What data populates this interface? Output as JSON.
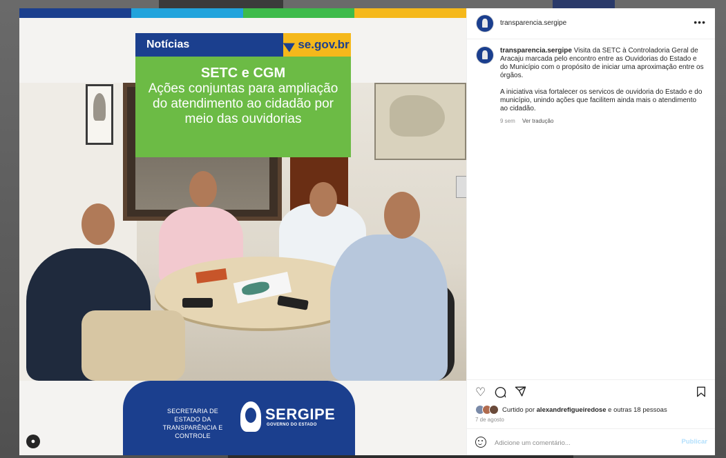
{
  "post_image": {
    "color_bar": [
      "#1b3f8e",
      "#22a3dc",
      "#3dbb4a",
      "#f5b81b"
    ],
    "news_tag": "Notícias",
    "gov_logo": "se.gov.br",
    "headline": "SETC e CGM",
    "subheadline": "Ações conjuntas para ampliação do atendimento ao cidadão por meio das ouvidorias",
    "secretaria": "SECRETARIA DE ESTADO DA TRANSPARÊNCIA E CONTROLE",
    "brand": "SERGIPE",
    "brand_sub": "GOVERNO DO ESTADO",
    "colors": {
      "blue": "#1b3f8e",
      "green": "#6cbb45",
      "yellow": "#f5b81b"
    }
  },
  "panel": {
    "username": "transparencia.sergipe",
    "more_icon": "more-horizontal-icon",
    "caption": {
      "username": "transparencia.sergipe",
      "paragraph1": "Visita da SETC à Controladoria Geral de Aracaju marcada pelo encontro entre as Ouvidorias do Estado e do Município com o propósito de iniciar uma aproximação entre os órgãos.",
      "paragraph2": "A iniciativa visa fortalecer os servicos de ouvidoria do Estado e do município, unindo ações que facilitem ainda mais o atendimento ao cidadão.",
      "time": "9 sem",
      "translate": "Ver tradução"
    },
    "likes": {
      "prefix": "Curtido por",
      "user": "alexandrefigueiredose",
      "suffix": "e outras 18 pessoas"
    },
    "date": "7 de agosto",
    "comment": {
      "placeholder": "Adicione um comentário...",
      "post_label": "Publicar"
    }
  }
}
